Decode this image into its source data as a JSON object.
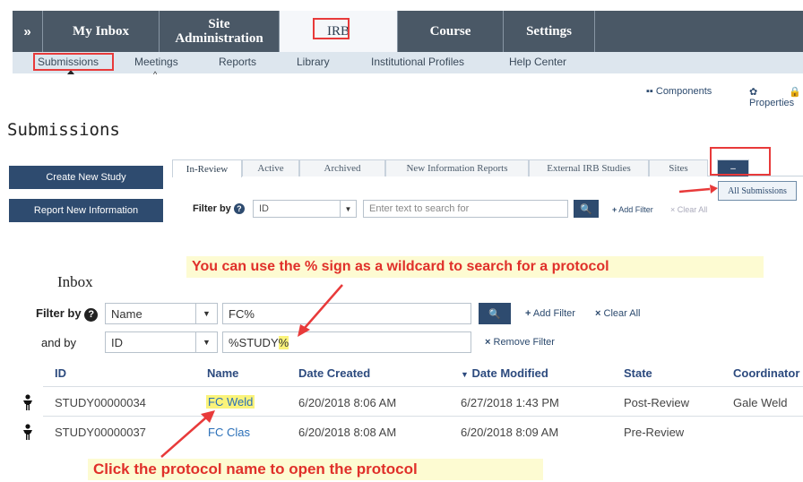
{
  "top_nav": {
    "expand": "»",
    "tabs": [
      "My Inbox",
      "Site Administration",
      "IRB",
      "Course",
      "Settings"
    ],
    "active": "IRB"
  },
  "sub_nav": [
    "Submissions",
    "Meetings",
    "Reports",
    "Library",
    "Institutional Profiles",
    "Help Center"
  ],
  "toolbar": {
    "components": "Components",
    "properties": "Properties"
  },
  "page_title": "Submissions",
  "side_buttons": [
    "Create New Study",
    "Report New Information"
  ],
  "tabs": [
    "In-Review",
    "Active",
    "Archived",
    "New Information Reports",
    "External IRB Studies",
    "Sites",
    "–"
  ],
  "dropdown_item": "All Submissions",
  "top_filter": {
    "label": "Filter by",
    "field": "ID",
    "placeholder": "Enter text to search for",
    "add_filter": "Add Filter",
    "clear_all": "Clear All"
  },
  "inbox": {
    "title": "Inbox",
    "filter_label": "Filter by",
    "filter_field": "Name",
    "filter_value": "FC%",
    "and_label": "and by",
    "and_field": "ID",
    "and_value_prefix": "%STUDY",
    "and_value_wildcard": "%",
    "add_filter": "Add Filter",
    "clear_all": "Clear All",
    "remove_filter": "Remove Filter",
    "columns": [
      "ID",
      "Name",
      "Date Created",
      "Date Modified",
      "State",
      "Coordinator"
    ],
    "rows": [
      {
        "id": "STUDY00000034",
        "name": "FC Weld",
        "created": "6/20/2018 8:06 AM",
        "modified": "6/27/2018 1:43 PM",
        "state": "Post-Review",
        "coordinator": "Gale Weld"
      },
      {
        "id": "STUDY00000037",
        "name": "FC Clas",
        "created": "6/20/2018 8:08 AM",
        "modified": "6/20/2018 8:09 AM",
        "state": "Pre-Review",
        "coordinator": ""
      }
    ]
  },
  "callouts": {
    "wildcard": "You can use the % sign as a wildcard to search for a protocol",
    "click": "Click the protocol name to open the protocol"
  },
  "colors": {
    "nav": "#4a5866",
    "button": "#2e4b6f",
    "annotation": "#e83a3a",
    "highlight": "#faf37a"
  }
}
